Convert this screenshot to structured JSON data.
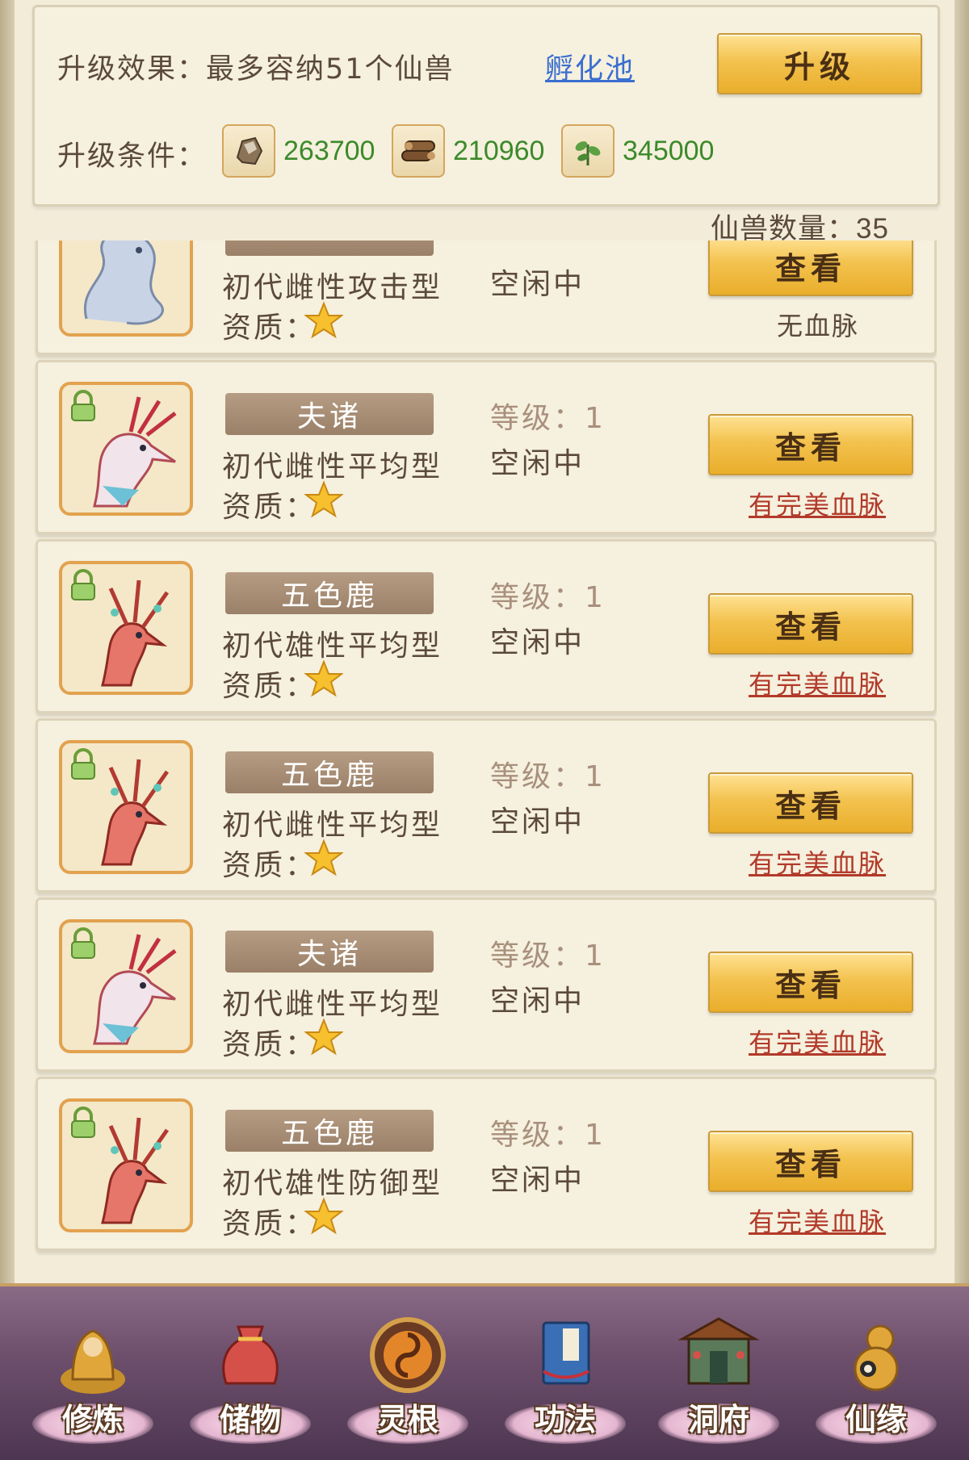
{
  "upgrade": {
    "effect_label": "升级效果：",
    "effect_text": "最多容纳51个仙兽",
    "pool_link": "孵化池",
    "upgrade_button": "升级",
    "condition_label": "升级条件：",
    "resources": [
      {
        "icon": "ore-icon",
        "value": "263700"
      },
      {
        "icon": "wood-icon",
        "value": "210960"
      },
      {
        "icon": "herb-icon",
        "value": "345000"
      }
    ]
  },
  "pet_count": {
    "label": "仙兽数量：",
    "value": "35"
  },
  "pets": [
    {
      "name": "",
      "type": "初代雌性攻击型",
      "quality_label": "资质：",
      "level_label": "",
      "status": "空闲中",
      "button": "查看",
      "bloodline": "无血脉",
      "bloodline_link": false,
      "avatar": "dragon"
    },
    {
      "name": "夫诸",
      "type": "初代雌性平均型",
      "quality_label": "资质：",
      "level_label": "等级：1",
      "status": "空闲中",
      "button": "查看",
      "bloodline": "有完美血脉",
      "bloodline_link": true,
      "avatar": "fuzhu"
    },
    {
      "name": "五色鹿",
      "type": "初代雄性平均型",
      "quality_label": "资质：",
      "level_label": "等级：1",
      "status": "空闲中",
      "button": "查看",
      "bloodline": "有完美血脉",
      "bloodline_link": true,
      "avatar": "deer"
    },
    {
      "name": "五色鹿",
      "type": "初代雌性平均型",
      "quality_label": "资质：",
      "level_label": "等级：1",
      "status": "空闲中",
      "button": "查看",
      "bloodline": "有完美血脉",
      "bloodline_link": true,
      "avatar": "deer"
    },
    {
      "name": "夫诸",
      "type": "初代雌性平均型",
      "quality_label": "资质：",
      "level_label": "等级：1",
      "status": "空闲中",
      "button": "查看",
      "bloodline": "有完美血脉",
      "bloodline_link": true,
      "avatar": "fuzhu"
    },
    {
      "name": "五色鹿",
      "type": "初代雄性防御型",
      "quality_label": "资质：",
      "level_label": "等级：1",
      "status": "空闲中",
      "button": "查看",
      "bloodline": "有完美血脉",
      "bloodline_link": true,
      "avatar": "deer"
    }
  ],
  "nav": [
    {
      "label": "修炼",
      "icon": "meditation-icon"
    },
    {
      "label": "储物",
      "icon": "bag-icon"
    },
    {
      "label": "灵根",
      "icon": "spirit-root-icon"
    },
    {
      "label": "功法",
      "icon": "book-icon"
    },
    {
      "label": "洞府",
      "icon": "mansion-icon"
    },
    {
      "label": "仙缘",
      "icon": "gourd-icon"
    }
  ],
  "colors": {
    "gold": "#f3c24f",
    "panel": "#f6f0de",
    "link_blue": "#3a6fd0",
    "bloodline_red": "#b23a2a",
    "resource_green": "#3b8a2a"
  }
}
